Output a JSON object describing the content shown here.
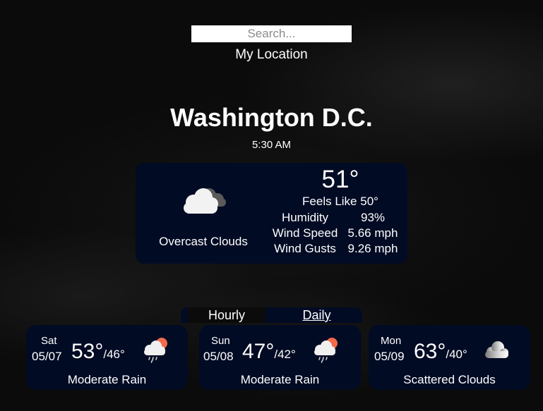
{
  "search": {
    "placeholder": "Search...",
    "my_location_label": "My Location"
  },
  "current": {
    "city": "Washington D.C.",
    "time": "5:30 AM",
    "icon": "overcast-clouds-icon",
    "temperature": "51°",
    "feels_like": "Feels Like 50°",
    "description": "Overcast Clouds",
    "stats": [
      {
        "label": "Humidity",
        "value": "93%"
      },
      {
        "label": "Wind Speed",
        "value": "5.66 mph"
      },
      {
        "label": "Wind Gusts",
        "value": "9.26 mph"
      }
    ]
  },
  "tabs": {
    "hourly": "Hourly",
    "daily": "Daily",
    "active": "Daily"
  },
  "forecast": [
    {
      "day": "Sat",
      "date": "05/07",
      "high": "53°",
      "low": "/46°",
      "icon": "rain-sun-cloud-icon",
      "condition": "Moderate Rain"
    },
    {
      "day": "Sun",
      "date": "05/08",
      "high": "47°",
      "low": "/42°",
      "icon": "rain-sun-cloud-icon",
      "condition": "Moderate Rain"
    },
    {
      "day": "Mon",
      "date": "05/09",
      "high": "63°",
      "low": "/40°",
      "icon": "scattered-clouds-icon",
      "condition": "Scattered Clouds"
    }
  ],
  "colors": {
    "background": "#0b0b0c",
    "card": "#020b24",
    "text": "#ffffff",
    "sun": "#f26b4c"
  }
}
